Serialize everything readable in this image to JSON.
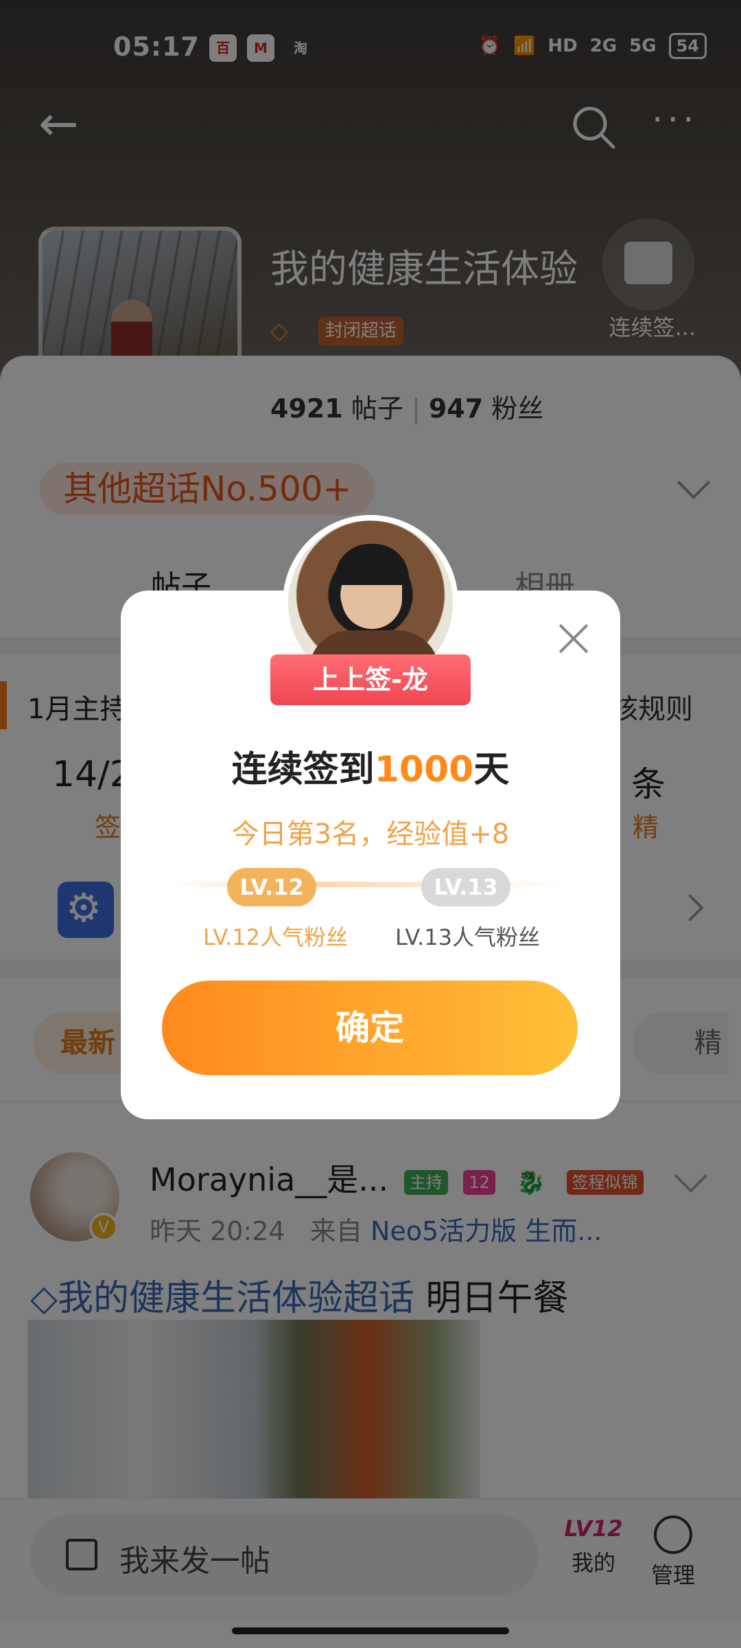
{
  "status": {
    "time": "05:17",
    "apps": [
      "百",
      "M",
      "淘"
    ],
    "network": "HD",
    "sig1": "2G",
    "sig2": "5G",
    "battery": "54"
  },
  "header": {
    "title": "我的健康生活体验",
    "closed_badge": "封闭超话",
    "checkin_label": "连续签..."
  },
  "stats": {
    "posts": "4921",
    "posts_label": "帖子",
    "fans": "947",
    "fans_label": "粉丝"
  },
  "rank": "其他超话No.500+",
  "tabs": [
    "帖子",
    "相册"
  ],
  "notice": {
    "left": "1月主持",
    "right": "核规则"
  },
  "counters": {
    "left_value": "14/2",
    "left_label": "签",
    "right_value": "条",
    "right_label": "精"
  },
  "sort": {
    "active": "最新",
    "right": "精"
  },
  "post": {
    "author": "Moraynia__是...",
    "tags": {
      "host": "主持",
      "level": "12",
      "badge": "签程似锦"
    },
    "time": "昨天 20:24",
    "from": "来自",
    "source": "Neo5活力版 生而...",
    "topic": "我的健康生活体验超话",
    "text": "明日午餐"
  },
  "composer": {
    "placeholder": "我来发一帖"
  },
  "nav": {
    "mine_level": "LV12",
    "mine": "我的",
    "manage": "管理"
  },
  "modal": {
    "ribbon": "上上签-龙",
    "title_pre": "连续签到",
    "title_num": "1000",
    "title_post": "天",
    "subtitle": "今日第3名，经验值+8",
    "lv_from": "LV.12",
    "lv_to": "LV.13",
    "lv_from_caption": "LV.12人气粉丝",
    "lv_to_caption": "LV.13人气粉丝",
    "confirm": "确定"
  },
  "colors": {
    "accent": "#ff8a18",
    "link": "#3b68b7",
    "ribbon": "#ef4652"
  }
}
